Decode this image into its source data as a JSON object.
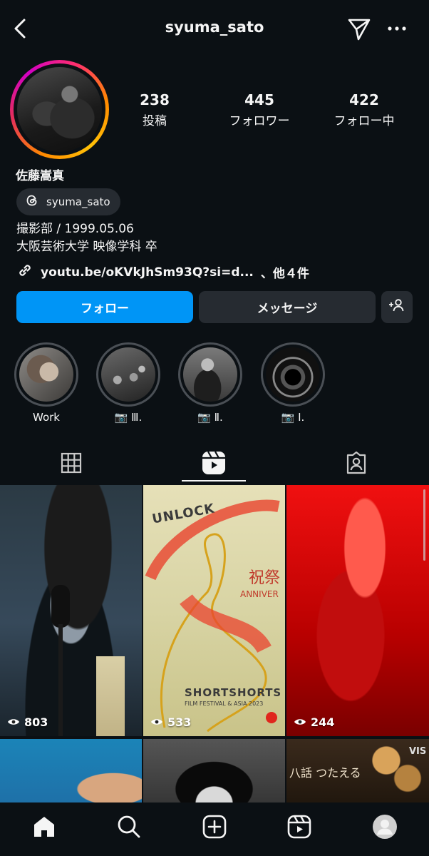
{
  "header": {
    "username": "syuma_sato"
  },
  "profile": {
    "display_name": "佐藤嵩真",
    "threads_handle": "syuma_sato",
    "bio_lines": [
      "撮影部 / 1999.05.06",
      "大阪芸術大学 映像学科 卒"
    ],
    "link_text": "youtu.be/oKVkJhSm93Q?si=d...",
    "link_suffix": "、他４件"
  },
  "stats": [
    {
      "value": "238",
      "label": "投稿"
    },
    {
      "value": "445",
      "label": "フォロワー"
    },
    {
      "value": "422",
      "label": "フォロー中"
    }
  ],
  "buttons": {
    "follow": "フォロー",
    "message": "メッセージ"
  },
  "highlights": [
    {
      "label": "Work"
    },
    {
      "label": "📷 Ⅲ."
    },
    {
      "label": "📷 Ⅱ."
    },
    {
      "label": "📷 Ⅰ."
    }
  ],
  "reels": [
    {
      "views": "803"
    },
    {
      "views": "533",
      "overlay_text": [
        "UNLOCK",
        "祝祭",
        "ANNIVER",
        "SHORTSHORTS",
        "FILM FESTIVAL & ASIA 2023"
      ]
    },
    {
      "views": "244"
    },
    {
      "views": ""
    },
    {
      "views": ""
    },
    {
      "views": "",
      "overlay_text": [
        "八話 つたえる",
        "VIS"
      ]
    }
  ],
  "tabs": [
    "grid-icon",
    "reels-icon",
    "tagged-icon"
  ],
  "nav": [
    "home-icon",
    "search-icon",
    "create-icon",
    "reels-icon",
    "profile-avatar"
  ],
  "colors": {
    "accent": "#0095f6",
    "background": "#0b1014",
    "button": "#262b31"
  }
}
